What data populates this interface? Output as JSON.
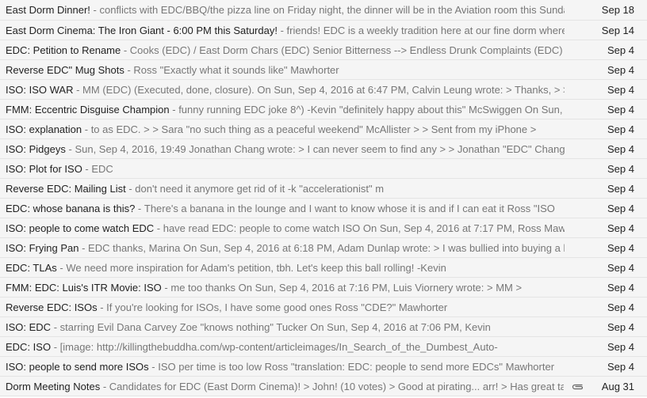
{
  "emails": [
    {
      "subject": "East Dorm Dinner!",
      "snippet": "conflicts with EDC/BBQ/the pizza line on Friday night, the dinner will be in the Aviation room this Sunday",
      "date": "Sep 18"
    },
    {
      "subject": "East Dorm Cinema: The Iron Giant - 6:00 PM this Saturday!",
      "snippet": "friends! EDC is a weekly tradition here at our fine dorm whereir",
      "date": "Sep 14"
    },
    {
      "subject": "EDC: Petition to Rename",
      "snippet": "Cooks (EDC) / East Dorm Chars (EDC) Senior Bitterness --> Endless Drunk Complaints (EDC) D",
      "date": "Sep 4"
    },
    {
      "subject": "Reverse EDC\" Mug Shots",
      "snippet": "Ross \"Exactly what it sounds like\" Mawhorter",
      "date": "Sep 4"
    },
    {
      "subject": "ISO: ISO WAR",
      "snippet": "MM (EDC) (Executed, done, closure). On Sun, Sep 4, 2016 at 6:47 PM, Calvin Leung wrote: > Thanks, > > (",
      "date": "Sep 4"
    },
    {
      "subject": "FMM: Eccentric Disguise Champion",
      "snippet": "funny running EDC joke 8^) -Kevin \"definitely happy about this\" McSwiggen On Sun, S",
      "date": "Sep 4"
    },
    {
      "subject": "ISO: explanation",
      "snippet": "to as EDC. > > Sara \"no such thing as a peaceful weekend\" McAllister > > Sent from my iPhone >",
      "date": "Sep 4"
    },
    {
      "subject": "ISO: Pidgeys",
      "snippet": "Sun, Sep 4, 2016, 19:49 Jonathan Chang wrote: > I can never seem to find any > > Jonathan \"EDC\" Chang >",
      "date": "Sep 4"
    },
    {
      "subject": "ISO: Plot for ISO",
      "snippet": "EDC",
      "date": "Sep 4"
    },
    {
      "subject": "Reverse EDC: Mailing List",
      "snippet": "don't need it anymore get rid of it -k \"accelerationist\" m",
      "date": "Sep 4"
    },
    {
      "subject": "EDC: whose banana is this?",
      "snippet": "There's a banana in the lounge and I want to know whose it is and if I can eat it Ross \"ISO",
      "date": "Sep 4"
    },
    {
      "subject": "ISO: people to come watch EDC",
      "snippet": "have read EDC: people to come watch ISO On Sun, Sep 4, 2016 at 7:17 PM, Ross Mawho",
      "date": "Sep 4"
    },
    {
      "subject": "ISO: Frying Pan",
      "snippet": "EDC thanks, Marina On Sun, Sep 4, 2016 at 6:18 PM, Adam Dunlap wrote: > I was bullied into buying a hc",
      "date": "Sep 4"
    },
    {
      "subject": "EDC: TLAs",
      "snippet": "We need more inspiration for Adam's petition, tbh. Let's keep this ball rolling! -Kevin",
      "date": "Sep 4"
    },
    {
      "subject": "FMM: EDC: Luis's ITR Movie: ISO",
      "snippet": "me too thanks On Sun, Sep 4, 2016 at 7:16 PM, Luis Viornery wrote: > MM >",
      "date": "Sep 4"
    },
    {
      "subject": "Reverse EDC: ISOs",
      "snippet": "If you're looking for ISOs, I have some good ones Ross \"CDE?\" Mawhorter",
      "date": "Sep 4"
    },
    {
      "subject": "ISO: EDC",
      "snippet": "starring Evil Dana Carvey Zoe \"knows nothing\" Tucker On Sun, Sep 4, 2016 at 7:06 PM, Kevin",
      "date": "Sep 4"
    },
    {
      "subject": "EDC: ISO",
      "snippet": "[image: http://killingthebuddha.com/wp-content/articleimages/In_Search_of_the_Dumbest_Auto-",
      "date": "Sep 4"
    },
    {
      "subject": "ISO: people to send more ISOs",
      "snippet": "ISO per time is too low Ross \"translation: EDC: people to send more EDCs\" Mawhorter",
      "date": "Sep 4"
    },
    {
      "subject": "Dorm Meeting Notes",
      "snippet": "Candidates for EDC (East Dorm Cinema)! > John! (10 votes) > Good at pirating... arr! > Has great tast",
      "date": "Aug 31",
      "attachment_icon": "paperclip-icon"
    }
  ],
  "separator": " - ",
  "colors": {
    "row_bg": "#f5f5f5",
    "border": "#e4e4e4",
    "subject": "#222222",
    "snippet": "#777777"
  }
}
